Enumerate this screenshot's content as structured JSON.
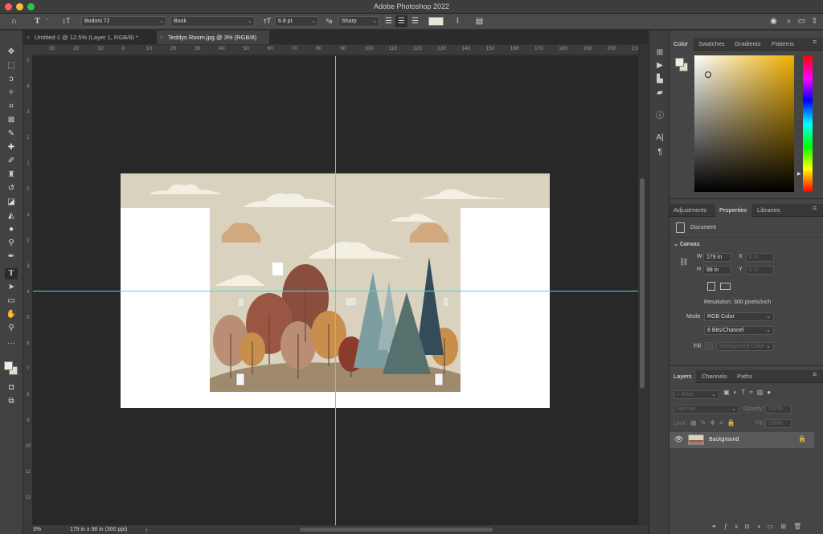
{
  "window": {
    "title": "Adobe Photoshop 2022"
  },
  "options_bar": {
    "font_family": "Bodoni 72",
    "font_style": "Book",
    "font_size": "6.8 pt",
    "antialias": "Sharp",
    "text_color": "#e8e4d8"
  },
  "tabs": [
    {
      "label": "Untitled-1 @ 12.5% (Layer 1, RGB/8) *",
      "active": false
    },
    {
      "label": "Teddys Room.jpg @ 3% (RGB/8)",
      "active": true
    }
  ],
  "ruler_top": [
    "30",
    "20",
    "10",
    "0",
    "10",
    "20",
    "30",
    "40",
    "50",
    "60",
    "70",
    "80",
    "90",
    "100",
    "110",
    "120",
    "130",
    "140",
    "150",
    "160",
    "170",
    "180",
    "190",
    "200",
    "210"
  ],
  "ruler_left": [
    "5",
    "4",
    "3",
    "2",
    "1",
    "0",
    "1",
    "2",
    "3",
    "4",
    "5",
    "6",
    "7",
    "8",
    "9",
    "10",
    "11",
    "12"
  ],
  "status": {
    "zoom": "3%",
    "doc_info": "179 in x 98 in (300 ppi)"
  },
  "color_panel": {
    "tabs": [
      "Color",
      "Swatches",
      "Gradients",
      "Patterns"
    ],
    "active_tab": "Color",
    "hue_color": "#f0b000"
  },
  "props_panel": {
    "tabs": [
      "Adjustments",
      "Properties",
      "Libraries"
    ],
    "active_tab": "Properties",
    "type": "Document",
    "section": "Canvas",
    "w_label": "W",
    "w_value": "179 in",
    "h_label": "H",
    "h_value": "98 in",
    "x_label": "X",
    "x_value": "0 in",
    "y_label": "Y",
    "y_value": "0 in",
    "resolution": "Resolution: 300 pixels/inch",
    "mode_label": "Mode",
    "mode_value": "RGB Color",
    "depth_value": "8 Bits/Channel",
    "fill_label": "Fill",
    "fill_value": "Background Color"
  },
  "layers_panel": {
    "tabs": [
      "Layers",
      "Channels",
      "Paths"
    ],
    "active_tab": "Layers",
    "kind_placeholder": "Kind",
    "blend_mode": "Normal",
    "opacity_label": "Opacity:",
    "opacity_value": "100%",
    "lock_label": "Lock:",
    "fill_label": "Fill:",
    "fill_value": "100%",
    "layers": [
      {
        "name": "Background",
        "visible": true,
        "locked": true
      }
    ]
  },
  "colors": {
    "guide": "#33e0e8",
    "art_bg": "#d9d2bf",
    "ground": "#a08a6e",
    "tree_brown": "#8a4e3f",
    "tree_tan": "#b98e74",
    "tree_ochre": "#c78e4c",
    "tree_rust": "#8b3a2c",
    "tree_teal": "#7d9ea0",
    "tree_slate": "#56706d",
    "tree_navy": "#344c59"
  }
}
